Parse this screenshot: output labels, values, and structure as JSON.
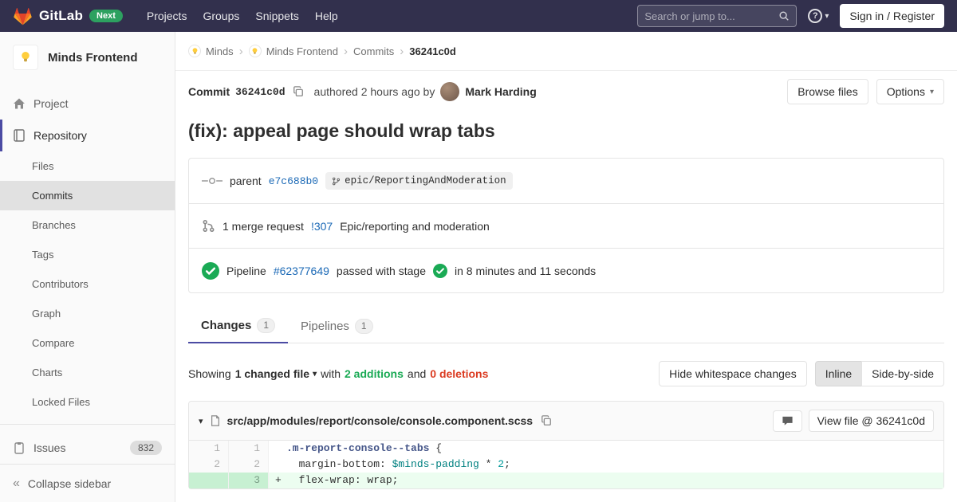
{
  "colors": {
    "navbar_bg": "#32304d",
    "accent": "#4b4ba3",
    "link": "#1b69b6",
    "success": "#1aaa55",
    "danger": "#db3b21",
    "added_line_bg": "#ecfdf0",
    "added_line_number_bg": "#c7f0d2",
    "next_badge_bg": "#2da160"
  },
  "glyphs": {
    "caret_down": "▾",
    "collapse": "«",
    "separator": "›",
    "question": "?"
  },
  "navbar": {
    "brand": "GitLab",
    "next_badge": "Next",
    "links": [
      "Projects",
      "Groups",
      "Snippets",
      "Help"
    ],
    "search": {
      "placeholder": "Search or jump to...",
      "value": ""
    },
    "signin": "Sign in / Register"
  },
  "sidebar": {
    "project_name": "Minds Frontend",
    "project_label": "Project",
    "repository_label": "Repository",
    "repo_sub_items": [
      "Files",
      "Commits",
      "Branches",
      "Tags",
      "Contributors",
      "Graph",
      "Compare",
      "Charts",
      "Locked Files"
    ],
    "issues_label": "Issues",
    "issues_count": "832",
    "collapse_label": "Collapse sidebar"
  },
  "breadcrumb": {
    "items": [
      "Minds",
      "Minds Frontend",
      "Commits"
    ],
    "current": "36241c0d"
  },
  "commit": {
    "label": "Commit",
    "sha": "36241c0d",
    "authored": "authored 2 hours ago by",
    "author": "Mark Harding",
    "browse_files": "Browse files",
    "options": "Options",
    "title": "(fix): appeal page should wrap tabs"
  },
  "info": {
    "parent_label": "parent",
    "parent_sha": "e7c688b0",
    "branch": "epic/ReportingAndModeration",
    "mr_text": "1 merge request",
    "mr_ref": "!307",
    "mr_title": "Epic/reporting and moderation",
    "pipeline_label": "Pipeline",
    "pipeline_id": "#62377649",
    "pipeline_status": "passed with stage",
    "pipeline_duration": "in 8 minutes and 11 seconds"
  },
  "tabs": {
    "changes_label": "Changes",
    "changes_count": "1",
    "pipelines_label": "Pipelines",
    "pipelines_count": "1"
  },
  "summary": {
    "showing": "Showing",
    "file_count": "1 changed file",
    "with_text": "with",
    "additions": "2 additions",
    "and_text": "and",
    "deletions": "0 deletions",
    "hide_whitespace": "Hide whitespace changes",
    "inline": "Inline",
    "side_by_side": "Side-by-side"
  },
  "diff": {
    "file_path": "src/app/modules/report/console/console.component.scss",
    "view_file": "View file @ 36241c0d",
    "lines": [
      {
        "old": "1",
        "new": "1",
        "sign": "",
        "code": [
          ".m-report-console--tabs",
          " {"
        ]
      },
      {
        "old": "2",
        "new": "2",
        "sign": "",
        "code": [
          "  margin-bottom: ",
          "$minds-padding",
          " * ",
          "2",
          ";"
        ]
      },
      {
        "old": "",
        "new": "3",
        "sign": "+",
        "code": [
          "  flex-wrap: wrap;"
        ]
      }
    ]
  }
}
